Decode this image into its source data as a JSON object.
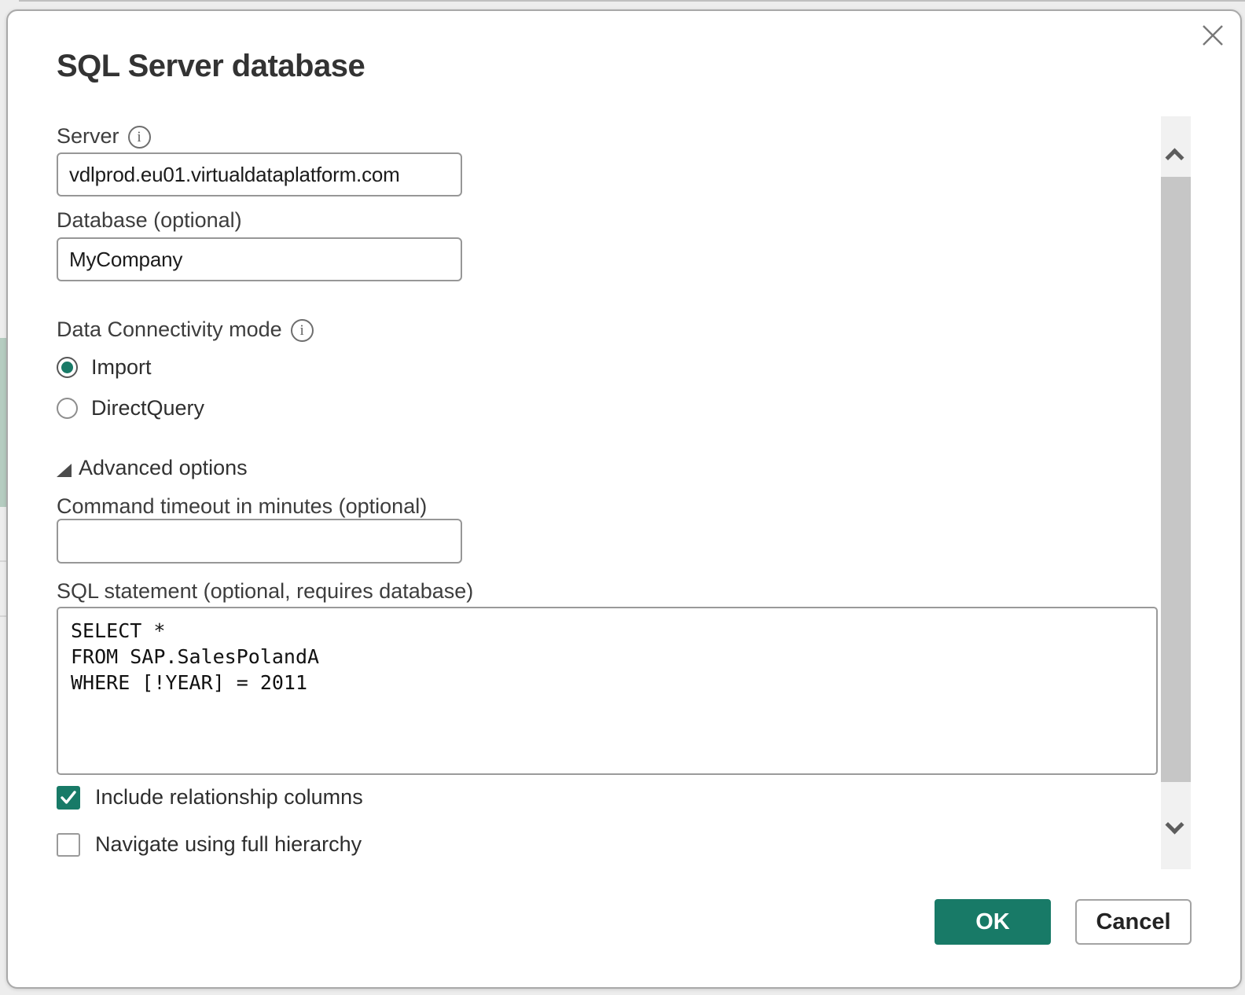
{
  "colors": {
    "accent": "#187a67",
    "dialog_border": "#a9a9a9",
    "scroll_track": "#f1f1f1",
    "scroll_thumb": "#c6c6c6"
  },
  "icons": {
    "info": "i"
  },
  "dialog": {
    "title": "SQL Server database",
    "server": {
      "label": "Server",
      "value": "vdlprod.eu01.virtualdataplatform.com"
    },
    "database": {
      "label": "Database (optional)",
      "value": "MyCompany"
    },
    "connectivity": {
      "label": "Data Connectivity mode",
      "options": [
        {
          "label": "Import",
          "selected": true
        },
        {
          "label": "DirectQuery",
          "selected": false
        }
      ]
    },
    "advanced": {
      "label": "Advanced options",
      "expanded": true
    },
    "timeout": {
      "label": "Command timeout in minutes (optional)",
      "value": ""
    },
    "sql": {
      "label": "SQL statement (optional, requires database)",
      "value": "SELECT *\nFROM SAP.SalesPolandA\nWHERE [!YEAR] = 2011"
    },
    "options": [
      {
        "label": "Include relationship columns",
        "checked": true
      },
      {
        "label": "Navigate using full hierarchy",
        "checked": false
      }
    ],
    "buttons": {
      "ok": "OK",
      "cancel": "Cancel"
    }
  }
}
